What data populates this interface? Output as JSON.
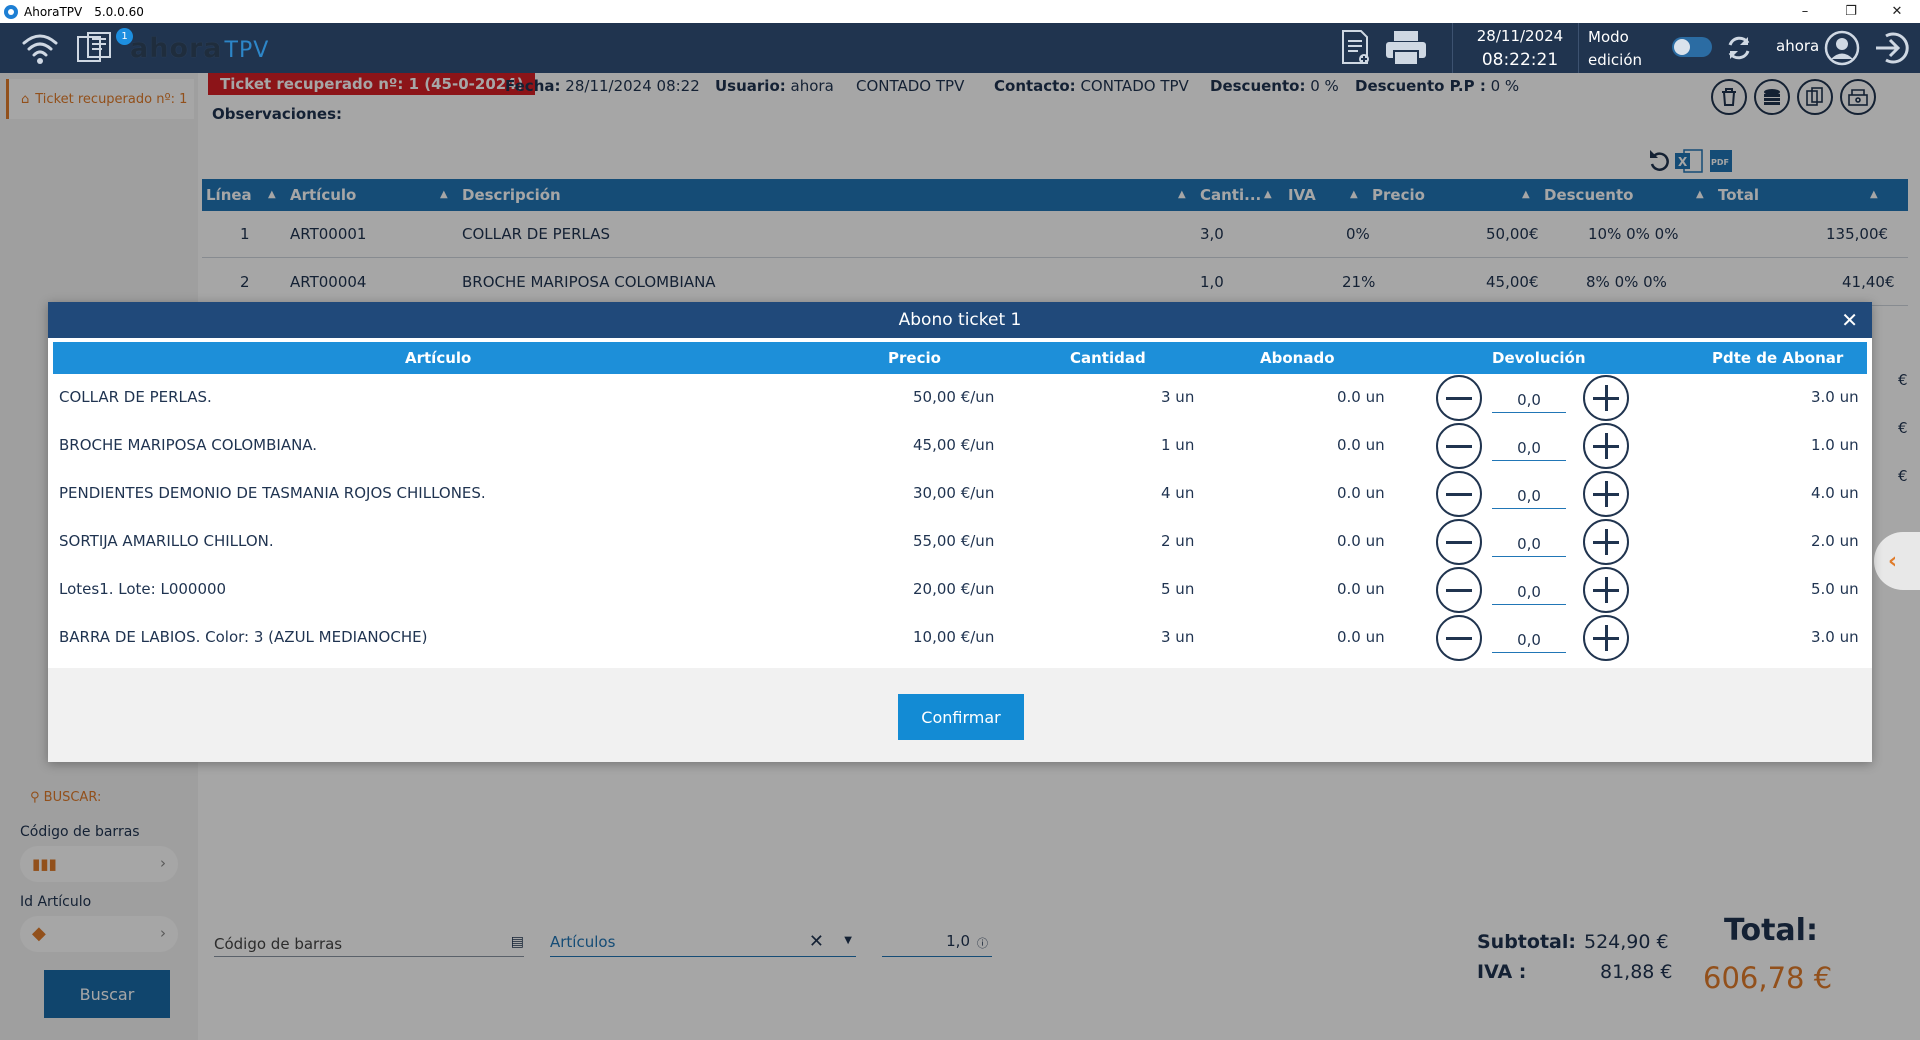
{
  "window": {
    "app_name": "AhoraTPV",
    "version": "5.0.0.60",
    "controls": [
      "–",
      "❐",
      "✕"
    ]
  },
  "appbar": {
    "ticket_badge": "1",
    "logo_text": "ahora",
    "logo_suffix": "TPV",
    "date": "28/11/2024",
    "time": "08:22:21",
    "mode_label_1": "Modo",
    "mode_label_2": "edición",
    "user": "ahora"
  },
  "sidebar": {
    "tab_label": "Ticket recuperado nº: 1",
    "search_title": "BUSCAR:",
    "barcode_label": "Código de barras",
    "article_id_label": "Id Artículo",
    "search_button": "Buscar"
  },
  "ticket": {
    "recovered_label": "Ticket recuperado nº: 1 (45-0-2024)",
    "fecha_label": "Fecha:",
    "fecha_value": "28/11/2024 08:22",
    "usuario_label": "Usuario:",
    "usuario_value": "ahora",
    "cliente": "CONTADO TPV",
    "contacto_label": "Contacto:",
    "contacto_value": "CONTADO TPV",
    "descuento_label": "Descuento:",
    "descuento_value": "0 %",
    "descuento_pp_label": "Descuento P.P :",
    "descuento_pp_value": "0 %",
    "observaciones_label": "Observaciones:"
  },
  "grid": {
    "headers": [
      "Línea",
      "Artículo",
      "Descripción",
      "Canti...",
      "IVA",
      "Precio",
      "Descuento",
      "Total"
    ],
    "rows": [
      {
        "linea": "1",
        "articulo": "ART00001",
        "descripcion": "COLLAR DE PERLAS",
        "cantidad": "3,0",
        "iva": "0%",
        "precio": "50,00€",
        "descuento": "10% 0% 0%",
        "total": "135,00€"
      },
      {
        "linea": "2",
        "articulo": "ART00004",
        "descripcion": "BROCHE MARIPOSA COLOMBIANA",
        "cantidad": "1,0",
        "iva": "21%",
        "precio": "45,00€",
        "descuento": "8% 0% 0%",
        "total": "41,40€"
      }
    ],
    "hidden_totals_edge": [
      "€",
      "€",
      "€"
    ]
  },
  "bottom": {
    "barcode_placeholder": "Código de barras",
    "articulos_placeholder": "Artículos",
    "quantity": "1,0",
    "subtotal_label": "Subtotal:",
    "subtotal_value": "524,90 €",
    "iva_label": "IVA :",
    "iva_value": "81,88 €",
    "total_label": "Total:",
    "total_value": "606,78 €"
  },
  "modal": {
    "title": "Abono ticket 1",
    "close": "✕",
    "headers": [
      "Artículo",
      "Precio",
      "Cantidad",
      "Abonado",
      "Devolución",
      "Pdte de Abonar"
    ],
    "rows": [
      {
        "articulo": "COLLAR DE PERLAS.",
        "precio": "50,00 €/un",
        "cantidad": "3 un",
        "abonado": "0.0 un",
        "devolucion": "0,0",
        "pendiente": "3.0 un"
      },
      {
        "articulo": "BROCHE MARIPOSA COLOMBIANA.",
        "precio": "45,00 €/un",
        "cantidad": "1 un",
        "abonado": "0.0 un",
        "devolucion": "0,0",
        "pendiente": "1.0 un"
      },
      {
        "articulo": "PENDIENTES DEMONIO DE TASMANIA ROJOS CHILLONES.",
        "precio": "30,00 €/un",
        "cantidad": "4 un",
        "abonado": "0.0 un",
        "devolucion": "0,0",
        "pendiente": "4.0 un"
      },
      {
        "articulo": "SORTIJA AMARILLO CHILLON.",
        "precio": "55,00 €/un",
        "cantidad": "2 un",
        "abonado": "0.0 un",
        "devolucion": "0,0",
        "pendiente": "2.0 un"
      },
      {
        "articulo": "Lotes1. Lote: L000000",
        "precio": "20,00 €/un",
        "cantidad": "5 un",
        "abonado": "0.0 un",
        "devolucion": "0,0",
        "pendiente": "5.0 un"
      },
      {
        "articulo": "BARRA DE LABIOS. Color: 3 (AZUL MEDIANOCHE)",
        "precio": "10,00 €/un",
        "cantidad": "3 un",
        "abonado": "0.0 un",
        "devolucion": "0,0",
        "pendiente": "3.0 un"
      }
    ],
    "confirm": "Confirmar"
  },
  "colors": {
    "appbar": "#20344f",
    "accent_orange": "#e07b2a",
    "grid_header": "#2176b6",
    "modal_header": "#1d8fd9",
    "recovered_red": "#d81f26"
  }
}
